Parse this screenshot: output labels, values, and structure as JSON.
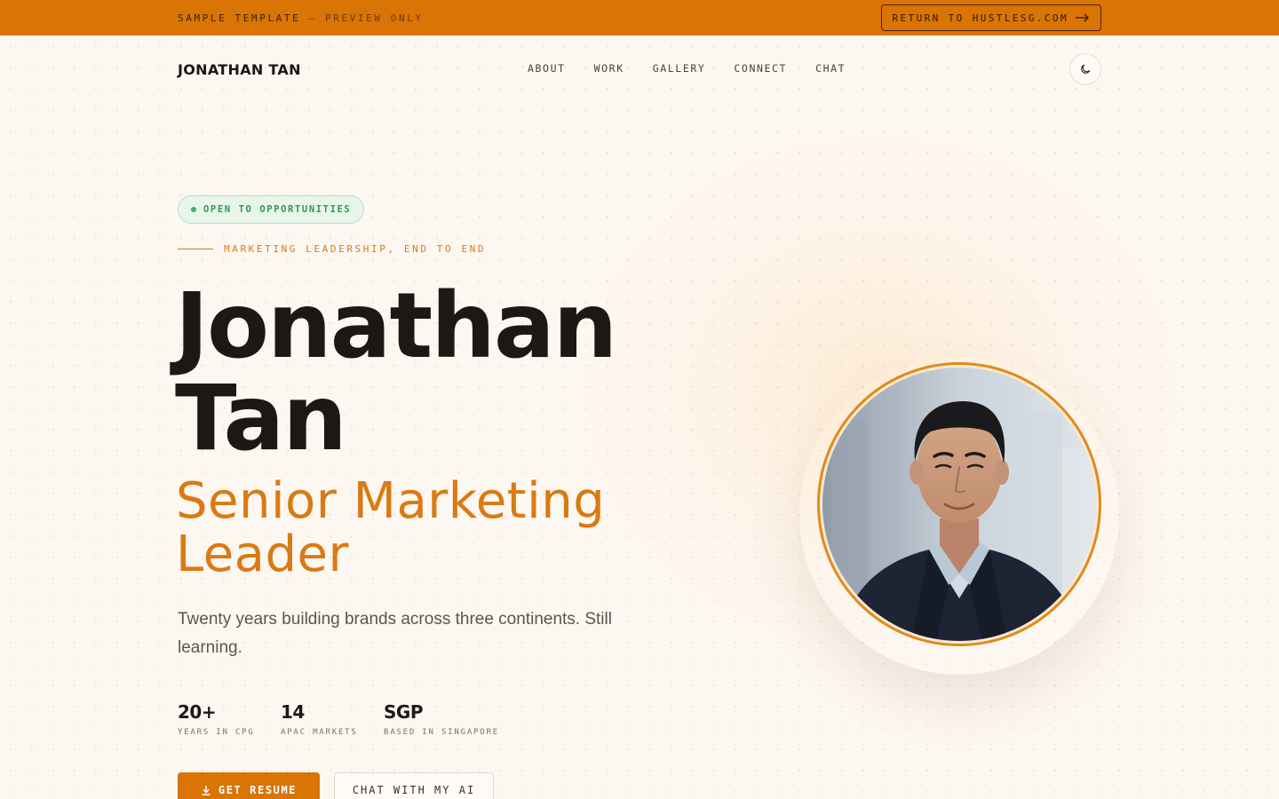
{
  "banner": {
    "text": "SAMPLE TEMPLATE",
    "text_muted": " — PREVIEW ONLY",
    "return_label": "RETURN TO HUSTLESG.COM",
    "return_icon": "arrow-right-icon"
  },
  "nav": {
    "logo": "JONATHAN TAN",
    "links": [
      "ABOUT",
      "WORK",
      "GALLERY",
      "CONNECT",
      "CHAT"
    ],
    "theme_toggle_icon": "moon-icon"
  },
  "hero": {
    "badge": "OPEN TO OPPORTUNITIES",
    "eyebrow": "MARKETING LEADERSHIP, END TO END",
    "name_line1": "Jonathan",
    "name_line2": "Tan",
    "role_line1": "Senior Marketing",
    "role_line2": "Leader",
    "tagline": "Twenty years building brands across three continents. Still learning.",
    "stats": [
      {
        "value": "20+",
        "label": "YEARS IN CPG"
      },
      {
        "value": "14",
        "label": "APAC MARKETS"
      },
      {
        "value": "SGP",
        "label": "BASED IN SINGAPORE"
      }
    ],
    "cta_primary": "GET RESUME",
    "cta_primary_icon": "download-icon",
    "cta_secondary": "CHAT WITH MY AI"
  },
  "colors": {
    "accent": "#d97405",
    "background": "#fdf7f1",
    "status_green": "#43b066"
  }
}
